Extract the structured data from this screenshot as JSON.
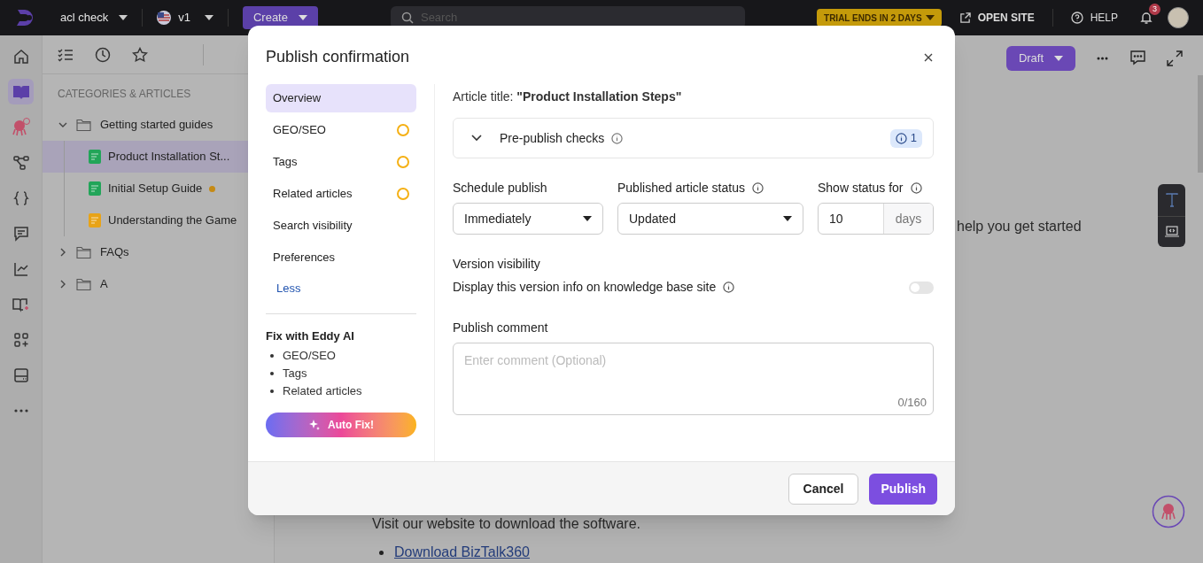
{
  "topbar": {
    "project": "acl check",
    "version": "v1",
    "create": "Create",
    "search_placeholder": "Search",
    "trial": "TRIAL ENDS IN 2 DAYS",
    "open_site": "OPEN SITE",
    "help": "HELP",
    "notifications": "3"
  },
  "rail": [
    {
      "kind": "home",
      "selected": false
    },
    {
      "kind": "book",
      "selected": true
    },
    {
      "kind": "bot",
      "selected": false
    },
    {
      "kind": "flow",
      "selected": false
    },
    {
      "kind": "braces",
      "selected": false
    },
    {
      "kind": "chat",
      "selected": false
    },
    {
      "kind": "chart",
      "selected": false
    },
    {
      "kind": "bookplus",
      "selected": false
    },
    {
      "kind": "apps",
      "selected": false
    },
    {
      "kind": "panel",
      "selected": false
    },
    {
      "kind": "more",
      "selected": false
    }
  ],
  "sidebar": {
    "heading": "CATEGORIES & ARTICLES",
    "tree": [
      {
        "label": "Getting started guides",
        "kind": "folder",
        "expanded": true,
        "children": [
          {
            "label": "Product Installation St...",
            "kind": "article",
            "color": "#22a559",
            "selected": true,
            "modified": false
          },
          {
            "label": "Initial Setup Guide",
            "kind": "article",
            "color": "#22a559",
            "selected": false,
            "modified": true
          },
          {
            "label": "Understanding the Game",
            "kind": "article",
            "color": "#e8a317",
            "selected": false,
            "modified": false
          }
        ]
      },
      {
        "label": "FAQs",
        "kind": "folder",
        "expanded": false
      },
      {
        "label": "A",
        "kind": "folder",
        "expanded": false
      }
    ]
  },
  "editor": {
    "status": "Draft",
    "text_fragment": "help you get started",
    "paragraph": "Visit our website to download the software.",
    "link": "Download BizTalk360"
  },
  "modal": {
    "title": "Publish confirmation",
    "nav": [
      {
        "label": "Overview",
        "selected": true,
        "pending": false
      },
      {
        "label": "GEO/SEO",
        "selected": false,
        "pending": true
      },
      {
        "label": "Tags",
        "selected": false,
        "pending": true
      },
      {
        "label": "Related articles",
        "selected": false,
        "pending": true
      },
      {
        "label": "Search visibility",
        "selected": false,
        "pending": false
      },
      {
        "label": "Preferences",
        "selected": false,
        "pending": false
      }
    ],
    "less": "Less",
    "fix_title": "Fix with Eddy AI",
    "fix_items": [
      "GEO/SEO",
      "Tags",
      "Related articles"
    ],
    "auto_fix": "Auto Fix!",
    "article_title": "Article title: **\"Product Installation Steps\"**",
    "checks": {
      "label": "Pre-publish checks",
      "expanded": false,
      "count": "1"
    },
    "schedule": {
      "label": "Schedule publish",
      "value": "Immediately"
    },
    "status": {
      "label": "Published article status",
      "value": "Updated"
    },
    "show_for": {
      "label": "Show status for",
      "value": "10",
      "unit": "days"
    },
    "version": {
      "title": "Version visibility",
      "description": "Display this version info on knowledge base site",
      "on": false
    },
    "comment": {
      "label": "Publish comment",
      "placeholder": "Enter comment (Optional)",
      "counter": "0/160"
    },
    "buttons": [
      "Cancel",
      "Publish"
    ]
  }
}
